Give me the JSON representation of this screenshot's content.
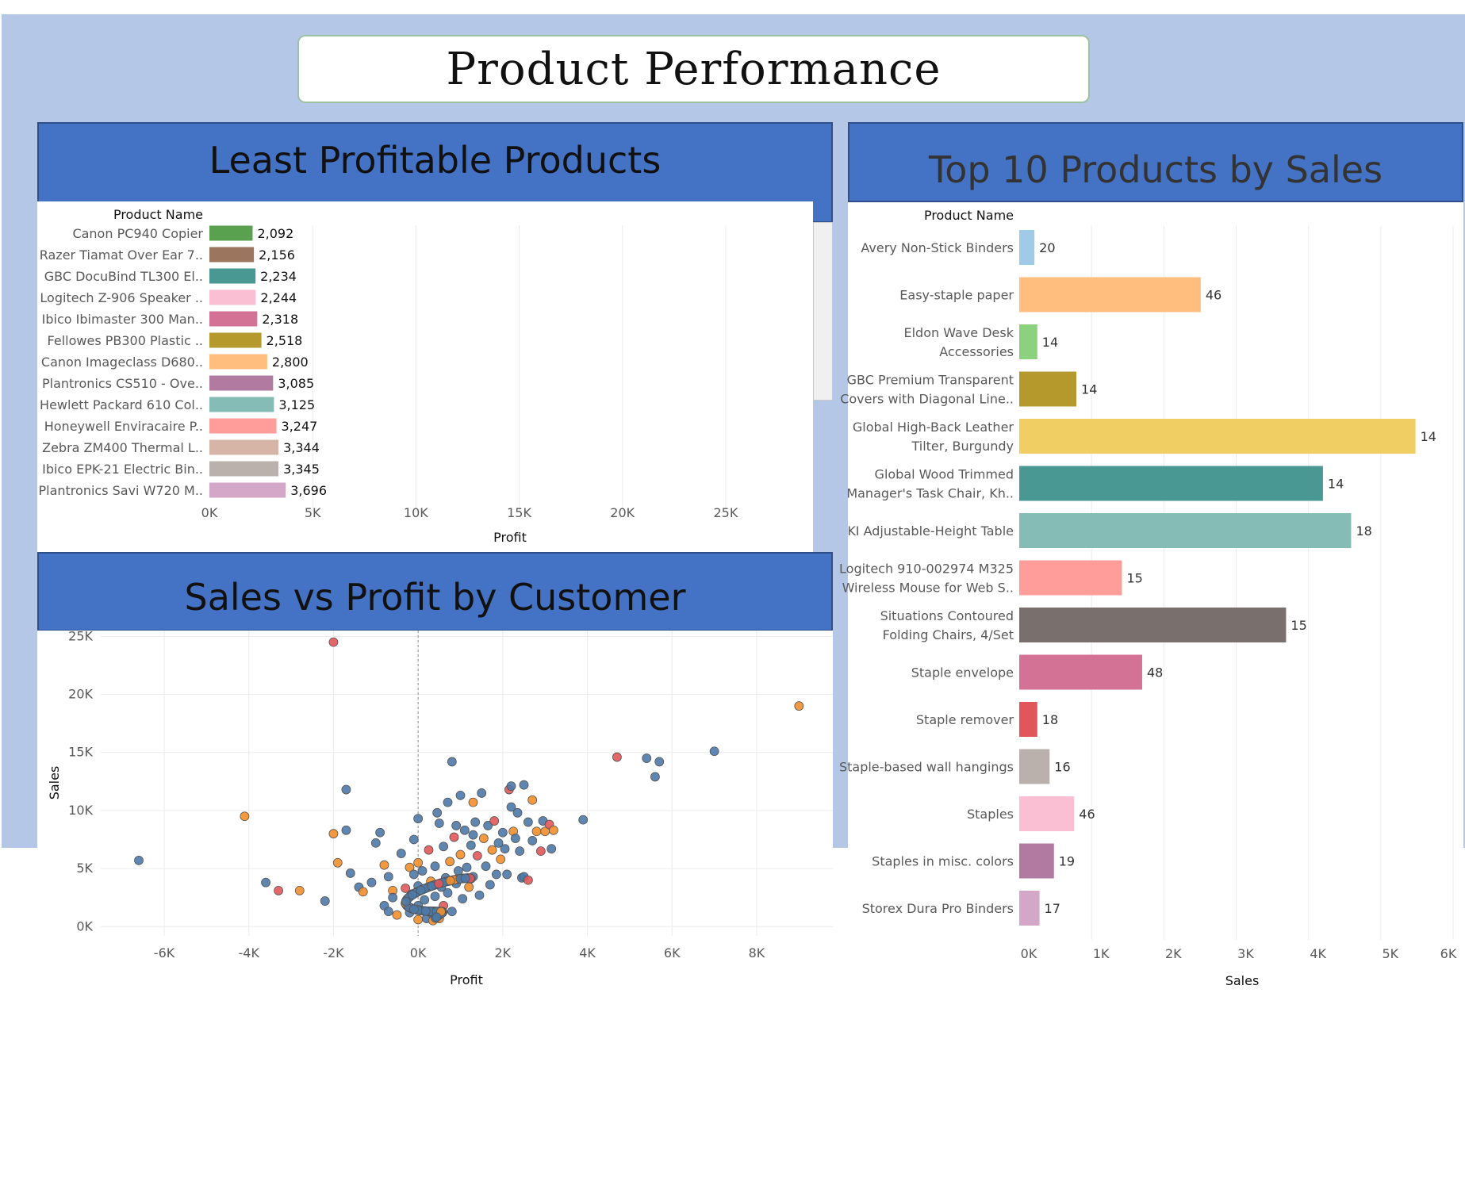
{
  "page_title": "Product Performance",
  "panels": {
    "least_profitable": "Least Profitable Products",
    "top10": "Top 10 Products by Sales",
    "scatter": "Sales vs Profit by Customer"
  },
  "chart_data": [
    {
      "id": "least_profitable",
      "type": "bar",
      "orientation": "horizontal",
      "row_header": "Product Name",
      "xlabel": "Profit",
      "xlim": [
        0,
        28000
      ],
      "xticks": [
        "0K",
        "5K",
        "10K",
        "15K",
        "20K",
        "25K"
      ],
      "xtick_values": [
        0,
        5000,
        10000,
        15000,
        20000,
        25000
      ],
      "categories": [
        "Canon PC940 Copier",
        "Razer Tiamat Over Ear 7..",
        "GBC DocuBind TL300 El..",
        "Logitech Z-906 Speaker ..",
        "Ibico Ibimaster 300 Man..",
        "Fellowes PB300 Plastic ..",
        "Canon Imageclass D680..",
        "Plantronics CS510 - Ove..",
        "Hewlett Packard 610 Col..",
        "Honeywell Enviracaire P..",
        "Zebra ZM400 Thermal L..",
        "Ibico EPK-21 Electric Bin..",
        "Plantronics Savi W720 M.."
      ],
      "values": [
        2092,
        2156,
        2234,
        2244,
        2318,
        2518,
        2800,
        3085,
        3125,
        3247,
        3344,
        3345,
        3696
      ],
      "value_labels": [
        "2,092",
        "2,156",
        "2,234",
        "2,244",
        "2,318",
        "2,518",
        "2,800",
        "3,085",
        "3,125",
        "3,247",
        "3,344",
        "3,345",
        "3,696"
      ],
      "colors": [
        "#59a14f",
        "#9c755f",
        "#499894",
        "#fabfd2",
        "#d37295",
        "#b6992d",
        "#ffbe7d",
        "#b07aa1",
        "#86bcb6",
        "#ff9d9a",
        "#d7b5a6",
        "#bab0ac",
        "#d4a6c8"
      ]
    },
    {
      "id": "top10",
      "type": "bar",
      "orientation": "horizontal",
      "row_header": "Product Name",
      "xlabel": "Sales",
      "xlim": [
        0,
        6000
      ],
      "xticks": [
        "0K",
        "1K",
        "2K",
        "3K",
        "4K",
        "5K",
        "6K"
      ],
      "xtick_values": [
        0,
        1000,
        2000,
        3000,
        4000,
        5000,
        6000
      ],
      "categories": [
        [
          "Avery Non-Stick Binders"
        ],
        [
          "Easy-staple paper"
        ],
        [
          "Eldon Wave Desk",
          "Accessories"
        ],
        [
          "GBC Premium Transparent",
          "Covers with Diagonal Line.."
        ],
        [
          "Global High-Back Leather",
          "Tilter, Burgundy"
        ],
        [
          "Global Wood Trimmed",
          "Manager's Task Chair, Kh.."
        ],
        [
          "KI Adjustable-Height Table"
        ],
        [
          "Logitech 910-002974 M325",
          "Wireless Mouse for Web S.."
        ],
        [
          "Situations Contoured",
          "Folding Chairs, 4/Set"
        ],
        [
          "Staple envelope"
        ],
        [
          "Staple remover"
        ],
        [
          "Staple-based wall hangings"
        ],
        [
          "Staples"
        ],
        [
          "Staples in misc. colors"
        ],
        [
          "Storex Dura Pro Binders"
        ]
      ],
      "values": [
        210,
        2510,
        250,
        790,
        5480,
        4200,
        4590,
        1420,
        3690,
        1700,
        250,
        420,
        760,
        480,
        280
      ],
      "value_labels": [
        "20",
        "46",
        "14",
        "14",
        "14",
        "14",
        "18",
        "15",
        "15",
        "48",
        "18",
        "16",
        "46",
        "19",
        "17"
      ],
      "colors": [
        "#a0cbe8",
        "#ffbe7d",
        "#8cd17d",
        "#b6992d",
        "#f1ce63",
        "#499894",
        "#86bcb6",
        "#ff9d9a",
        "#79706e",
        "#d37295",
        "#e15759",
        "#bab0ac",
        "#fabfd2",
        "#b07aa1",
        "#d4a6c8"
      ]
    },
    {
      "id": "scatter",
      "type": "scatter",
      "xlabel": "Profit",
      "ylabel": "Sales",
      "xlim": [
        -7500,
        9800
      ],
      "ylim": [
        -800,
        25500
      ],
      "xticks": [
        "-6K",
        "-4K",
        "-2K",
        "0K",
        "2K",
        "4K",
        "6K",
        "8K"
      ],
      "xtick_values": [
        -6000,
        -4000,
        -2000,
        0,
        2000,
        4000,
        6000,
        8000
      ],
      "yticks": [
        "0K",
        "5K",
        "10K",
        "15K",
        "20K",
        "25K"
      ],
      "ytick_values": [
        0,
        5000,
        10000,
        15000,
        20000,
        25000
      ],
      "reference_line_x": 0,
      "colors": {
        "blue": "#4e79a7",
        "orange": "#f28e2b",
        "red": "#e15759"
      },
      "points": [
        [
          -2000,
          24500,
          "red"
        ],
        [
          9000,
          19000,
          "orange"
        ],
        [
          7000,
          15100,
          "blue"
        ],
        [
          4700,
          14600,
          "red"
        ],
        [
          5400,
          14500,
          "blue"
        ],
        [
          5700,
          14200,
          "blue"
        ],
        [
          5600,
          12900,
          "blue"
        ],
        [
          800,
          14200,
          "blue"
        ],
        [
          -1700,
          11800,
          "blue"
        ],
        [
          -4100,
          9500,
          "orange"
        ],
        [
          3900,
          9200,
          "blue"
        ],
        [
          -6600,
          5700,
          "blue"
        ],
        [
          -3600,
          3800,
          "blue"
        ],
        [
          -3300,
          3100,
          "red"
        ],
        [
          -2800,
          3100,
          "orange"
        ],
        [
          -2200,
          2200,
          "blue"
        ],
        [
          -2000,
          8000,
          "orange"
        ],
        [
          -1700,
          8300,
          "blue"
        ],
        [
          -1900,
          5500,
          "orange"
        ],
        [
          -1600,
          4600,
          "blue"
        ],
        [
          -1400,
          3400,
          "blue"
        ],
        [
          -1300,
          3000,
          "orange"
        ],
        [
          -1100,
          3800,
          "blue"
        ],
        [
          -1000,
          7200,
          "blue"
        ],
        [
          -900,
          8100,
          "blue"
        ],
        [
          -800,
          5300,
          "orange"
        ],
        [
          -700,
          4300,
          "blue"
        ],
        [
          -600,
          3100,
          "orange"
        ],
        [
          -800,
          1800,
          "blue"
        ],
        [
          -700,
          1300,
          "blue"
        ],
        [
          -600,
          2500,
          "blue"
        ],
        [
          -500,
          1000,
          "orange"
        ],
        [
          -400,
          6300,
          "blue"
        ],
        [
          -300,
          3300,
          "red"
        ],
        [
          -300,
          2000,
          "blue"
        ],
        [
          -200,
          5100,
          "orange"
        ],
        [
          -200,
          1200,
          "blue"
        ],
        [
          -100,
          7500,
          "blue"
        ],
        [
          -100,
          4500,
          "blue"
        ],
        [
          -150,
          2800,
          "red"
        ],
        [
          0,
          9300,
          "blue"
        ],
        [
          0,
          5500,
          "orange"
        ],
        [
          0,
          3500,
          "blue"
        ],
        [
          0,
          1800,
          "blue"
        ],
        [
          0,
          600,
          "orange"
        ],
        [
          100,
          4800,
          "blue"
        ],
        [
          150,
          2300,
          "blue"
        ],
        [
          200,
          700,
          "blue"
        ],
        [
          250,
          6600,
          "red"
        ],
        [
          300,
          3900,
          "orange"
        ],
        [
          300,
          1200,
          "blue"
        ],
        [
          400,
          5200,
          "blue"
        ],
        [
          400,
          2600,
          "blue"
        ],
        [
          450,
          9800,
          "blue"
        ],
        [
          500,
          700,
          "orange"
        ],
        [
          550,
          3400,
          "blue"
        ],
        [
          600,
          6900,
          "blue"
        ],
        [
          600,
          1800,
          "red"
        ],
        [
          650,
          4200,
          "blue"
        ],
        [
          700,
          2900,
          "blue"
        ],
        [
          750,
          5600,
          "orange"
        ],
        [
          800,
          1300,
          "blue"
        ],
        [
          850,
          7700,
          "red"
        ],
        [
          900,
          3700,
          "blue"
        ],
        [
          950,
          4800,
          "blue"
        ],
        [
          1000,
          11300,
          "blue"
        ],
        [
          1000,
          6200,
          "orange"
        ],
        [
          1050,
          2400,
          "blue"
        ],
        [
          1100,
          8300,
          "blue"
        ],
        [
          1150,
          5100,
          "blue"
        ],
        [
          1200,
          3400,
          "orange"
        ],
        [
          1250,
          7000,
          "blue"
        ],
        [
          1300,
          10700,
          "orange"
        ],
        [
          1300,
          4300,
          "blue"
        ],
        [
          1350,
          9000,
          "blue"
        ],
        [
          1400,
          6100,
          "red"
        ],
        [
          1450,
          2700,
          "blue"
        ],
        [
          1500,
          11500,
          "blue"
        ],
        [
          1550,
          7600,
          "orange"
        ],
        [
          1600,
          5200,
          "blue"
        ],
        [
          1650,
          8700,
          "blue"
        ],
        [
          1700,
          3600,
          "blue"
        ],
        [
          1750,
          6600,
          "orange"
        ],
        [
          1800,
          9100,
          "red"
        ],
        [
          1850,
          4500,
          "blue"
        ],
        [
          1900,
          7200,
          "blue"
        ],
        [
          1950,
          5800,
          "orange"
        ],
        [
          2000,
          8100,
          "blue"
        ],
        [
          2050,
          6700,
          "blue"
        ],
        [
          2100,
          4500,
          "blue"
        ],
        [
          2150,
          11800,
          "red"
        ],
        [
          2200,
          12100,
          "blue"
        ],
        [
          2200,
          10300,
          "blue"
        ],
        [
          2250,
          8200,
          "orange"
        ],
        [
          2300,
          7600,
          "blue"
        ],
        [
          2350,
          9800,
          "blue"
        ],
        [
          2400,
          6500,
          "blue"
        ],
        [
          2450,
          4200,
          "blue"
        ],
        [
          2500,
          4300,
          "blue"
        ],
        [
          2600,
          9000,
          "blue"
        ],
        [
          2700,
          10900,
          "orange"
        ],
        [
          2700,
          7400,
          "blue"
        ],
        [
          2800,
          8200,
          "orange"
        ],
        [
          2900,
          6500,
          "red"
        ],
        [
          2950,
          9100,
          "blue"
        ],
        [
          3000,
          8200,
          "orange"
        ],
        [
          3100,
          8800,
          "red"
        ],
        [
          3150,
          6700,
          "blue"
        ],
        [
          3200,
          8300,
          "orange"
        ],
        [
          2600,
          4000,
          "red"
        ],
        [
          2500,
          12200,
          "blue"
        ],
        [
          700,
          10700,
          "blue"
        ],
        [
          900,
          8700,
          "blue"
        ],
        [
          1300,
          7900,
          "blue"
        ],
        [
          500,
          8900,
          "blue"
        ]
      ]
    }
  ]
}
